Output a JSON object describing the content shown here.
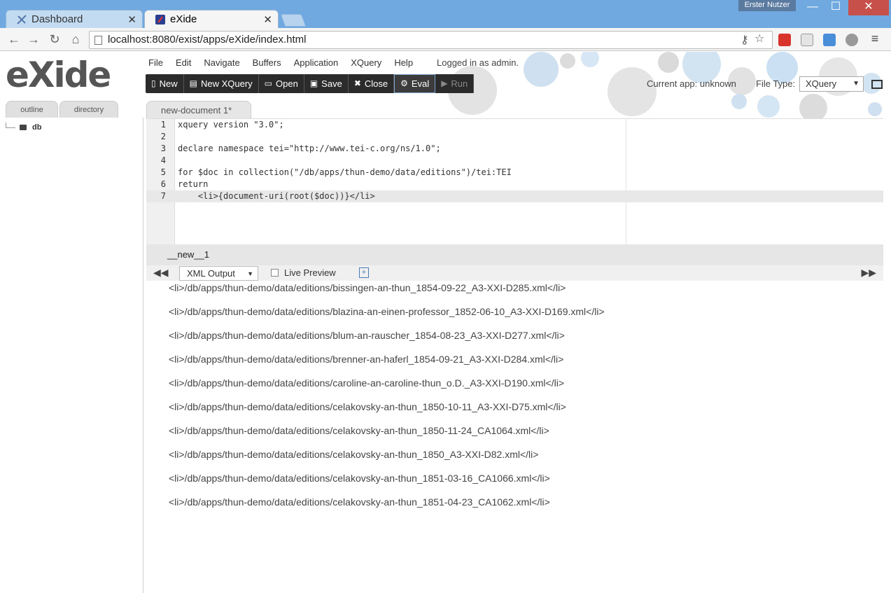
{
  "browser": {
    "tabs": [
      {
        "title": "Dashboard",
        "active": false
      },
      {
        "title": "eXide",
        "active": true
      }
    ],
    "profile_name": "Erster Nutzer",
    "url": "localhost:8080/exist/apps/eXide/index.html"
  },
  "app": {
    "logo": "eXide",
    "menu": [
      "File",
      "Edit",
      "Navigate",
      "Buffers",
      "Application",
      "XQuery",
      "Help"
    ],
    "login_status": "Logged in as admin.",
    "toolbar": {
      "new": "New",
      "new_xquery": "New XQuery",
      "open": "Open",
      "save": "Save",
      "close": "Close",
      "eval": "Eval",
      "run": "Run"
    },
    "current_app": "Current app: unknown",
    "file_type_label": "File Type:",
    "file_type_value": "XQuery",
    "sidebar_tabs": [
      "outline",
      "directory"
    ],
    "tree_root": "db",
    "document_tab": "new-document 1*",
    "editor_lines": [
      {
        "num": "1",
        "code": "xquery version \"3.0\";"
      },
      {
        "num": "2",
        "code": ""
      },
      {
        "num": "3",
        "code": "declare namespace tei=\"http://www.tei-c.org/ns/1.0\";"
      },
      {
        "num": "4",
        "code": ""
      },
      {
        "num": "5",
        "code": "for $doc in collection(\"/db/apps/thun-demo/data/editions\")/tei:TEI"
      },
      {
        "num": "6",
        "code": "return"
      },
      {
        "num": "7",
        "code": "    <li>{document-uri(root($doc))}</li>"
      }
    ],
    "status_label": "__new__1",
    "output_format": "XML Output",
    "live_preview_label": "Live Preview",
    "results": [
      "<li>/db/apps/thun-demo/data/editions/bissingen-an-thun_1854-09-22_A3-XXI-D285.xml</li>",
      "<li>/db/apps/thun-demo/data/editions/blazina-an-einen-professor_1852-06-10_A3-XXI-D169.xml</li>",
      "<li>/db/apps/thun-demo/data/editions/blum-an-rauscher_1854-08-23_A3-XXI-D277.xml</li>",
      "<li>/db/apps/thun-demo/data/editions/brenner-an-haferl_1854-09-21_A3-XXI-D284.xml</li>",
      "<li>/db/apps/thun-demo/data/editions/caroline-an-caroline-thun_o.D._A3-XXI-D190.xml</li>",
      "<li>/db/apps/thun-demo/data/editions/celakovsky-an-thun_1850-10-11_A3-XXI-D75.xml</li>",
      "<li>/db/apps/thun-demo/data/editions/celakovsky-an-thun_1850-11-24_CA1064.xml</li>",
      "<li>/db/apps/thun-demo/data/editions/celakovsky-an-thun_1850_A3-XXI-D82.xml</li>",
      "<li>/db/apps/thun-demo/data/editions/celakovsky-an-thun_1851-03-16_CA1066.xml</li>",
      "<li>/db/apps/thun-demo/data/editions/celakovsky-an-thun_1851-04-23_CA1062.xml</li>"
    ]
  }
}
